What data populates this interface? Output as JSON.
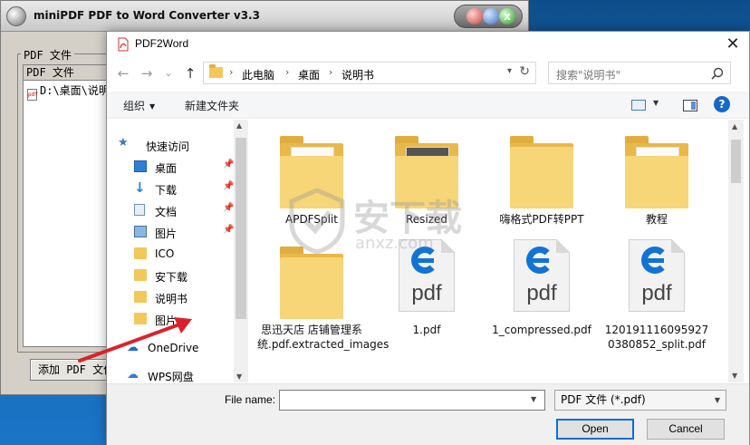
{
  "app": {
    "title": "miniPDF PDF to Word Converter v3.3",
    "group_title": "PDF 文件",
    "list_header": "PDF 文件",
    "list_rows": [
      "D:\\桌面\\说明"
    ],
    "add_button": "添加 PDF 文件",
    "close_glyph": "x"
  },
  "dialog": {
    "title": "PDF2Word",
    "close_glyph": "✕",
    "nav": {
      "back": "←",
      "forward": "→",
      "recent": "⌄",
      "up": "↑"
    },
    "breadcrumb": [
      "此电脑",
      "桌面",
      "说明书"
    ],
    "breadcrumb_sep": "›",
    "search_placeholder": "搜索\"说明书\"",
    "toolbar": {
      "organize": "组织",
      "new_folder": "新建文件夹"
    },
    "sidebar": [
      {
        "label": "快速访问",
        "icon": "star-icon"
      },
      {
        "label": "桌面",
        "icon": "desktop-icon",
        "pinned": true
      },
      {
        "label": "下载",
        "icon": "download-icon",
        "pinned": true
      },
      {
        "label": "文档",
        "icon": "document-icon",
        "pinned": true
      },
      {
        "label": "图片",
        "icon": "picture-icon",
        "pinned": true
      },
      {
        "label": "ICO",
        "icon": "folder-icon"
      },
      {
        "label": "安下载",
        "icon": "folder-icon"
      },
      {
        "label": "说明书",
        "icon": "folder-icon"
      },
      {
        "label": "图片",
        "icon": "folder-icon"
      },
      {
        "label": "OneDrive",
        "icon": "cloud-icon"
      },
      {
        "label": "WPS网盘",
        "icon": "cloud-icon"
      }
    ],
    "files": [
      {
        "name": "APDFSplit",
        "type": "folder"
      },
      {
        "name": "Resized",
        "type": "folder"
      },
      {
        "name": "嗨格式PDF转PPT",
        "type": "folder"
      },
      {
        "name": "教程",
        "type": "folder"
      },
      {
        "name": "思迅天店 店铺管理系统.pdf.extracted_images",
        "type": "folder"
      },
      {
        "name": "1.pdf",
        "type": "pdf"
      },
      {
        "name": "1_compressed.pdf",
        "type": "pdf"
      },
      {
        "name": "1201911160959270380852_split.pdf",
        "type": "pdf"
      }
    ],
    "pdf_glyph": "pdf",
    "file_name_label": "File name:",
    "file_name_value": "",
    "file_type": "PDF 文件 (*.pdf)",
    "open_button": "Open",
    "cancel_button": "Cancel"
  },
  "watermark": {
    "big": "安下载",
    "small": "anxz.com"
  },
  "colors": {
    "accent": "#0a6fd8",
    "arrow": "#d9232a",
    "folder": "#f3c85a"
  }
}
